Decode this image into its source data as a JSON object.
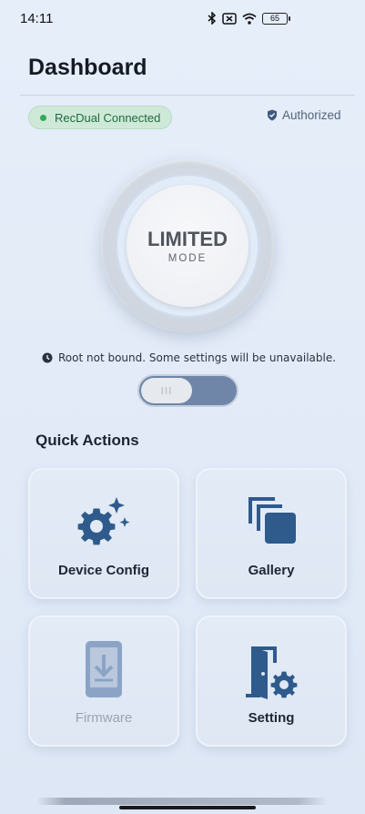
{
  "status_bar": {
    "time": "14:11",
    "battery": "65"
  },
  "header": {
    "title": "Dashboard"
  },
  "connection": {
    "label": "RecDual Connected",
    "color": "#36a85a"
  },
  "auth": {
    "label": "Authorized"
  },
  "mode": {
    "title": "LIMITED",
    "subtitle": "MODE"
  },
  "warning": {
    "text": "Root not bound. Some settings will be unavailable."
  },
  "toggle": {
    "knob_glyph": "III",
    "on": false
  },
  "quick_actions": {
    "title": "Quick Actions",
    "items": [
      {
        "label": "Device Config",
        "icon": "gear-sparkle-icon",
        "enabled": true
      },
      {
        "label": "Gallery",
        "icon": "stacked-squares-icon",
        "enabled": true
      },
      {
        "label": "Firmware",
        "icon": "phone-download-icon",
        "enabled": false
      },
      {
        "label": "Setting",
        "icon": "door-gear-icon",
        "enabled": true
      }
    ]
  },
  "colors": {
    "accent": "#2f5a8c",
    "background": "#e2eaf7"
  }
}
